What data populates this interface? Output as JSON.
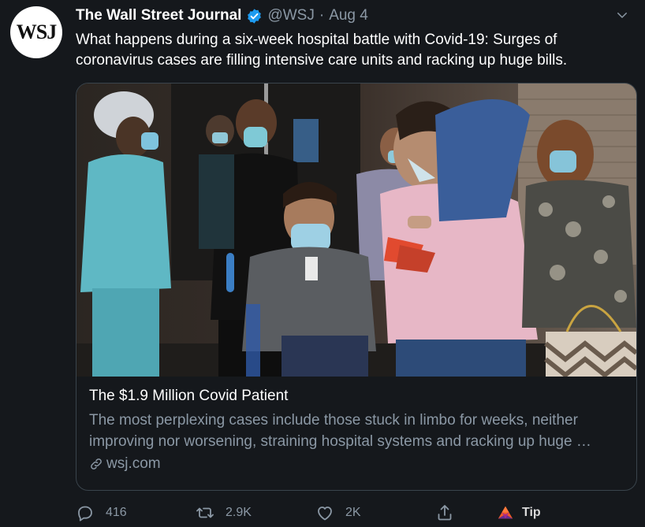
{
  "author": {
    "avatar_text": "WSJ",
    "name": "The Wall Street Journal",
    "handle": "@WSJ",
    "separator": "·",
    "date": "Aug 4"
  },
  "tweet": {
    "text": "What happens during a six-week hospital battle with Covid-19: Surges of coronavirus cases are filling intensive care units and racking up huge bills."
  },
  "card": {
    "title": "The $1.9 Million Covid Patient",
    "description": "The most perplexing cases include those stuck in limbo for weeks, neither improving nor worsening, straining hospital systems and racking up huge …",
    "domain": "wsj.com"
  },
  "actions": {
    "reply_count": "416",
    "retweet_count": "2.9K",
    "like_count": "2K",
    "tip_label": "Tip"
  },
  "icons": {
    "verified": "verified-badge-icon",
    "more": "chevron-down-icon",
    "link": "link-icon",
    "reply": "reply-icon",
    "retweet": "retweet-icon",
    "like": "heart-icon",
    "share": "share-icon",
    "tip": "brave-tip-icon"
  },
  "colors": {
    "background": "#15181c",
    "verified": "#1d9bf0",
    "muted": "#8b98a5",
    "border": "#3a444c",
    "scrubs": "#5fb8c4",
    "tip_orange": "#f15a24"
  }
}
